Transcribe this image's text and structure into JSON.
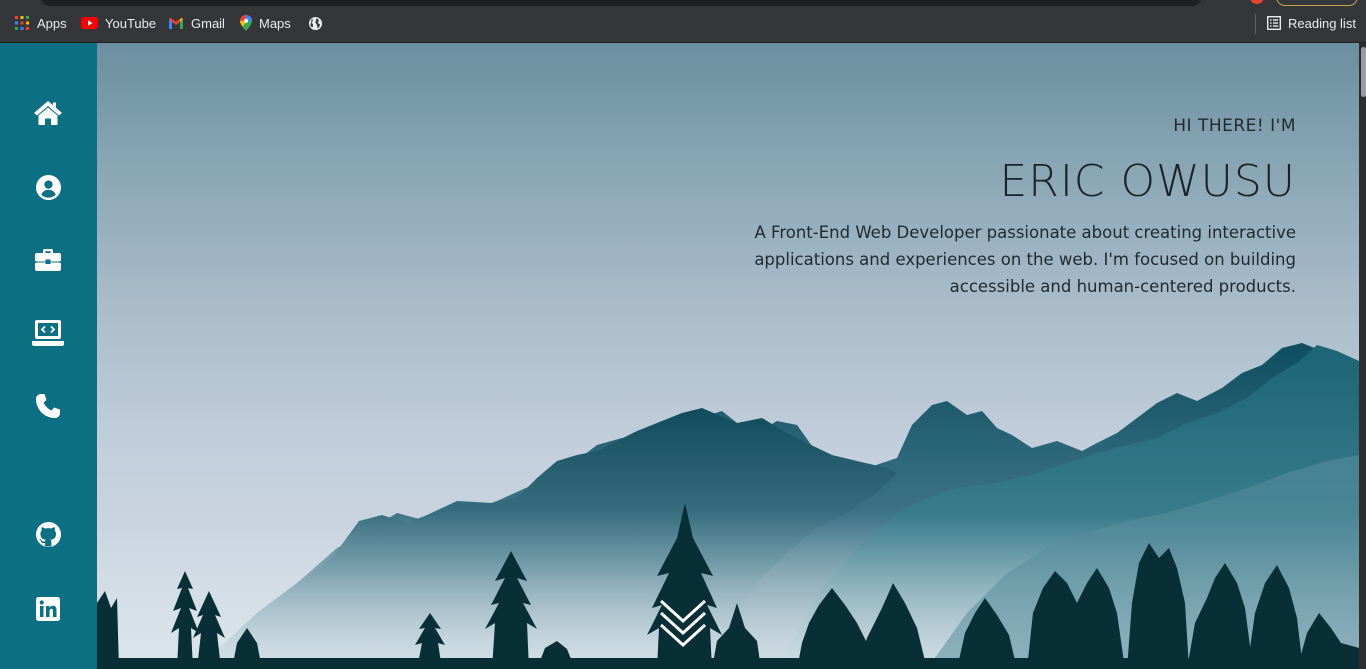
{
  "bookmarks_bar": {
    "items": [
      {
        "label": "Apps",
        "icon": "apps-grid-icon"
      },
      {
        "label": "YouTube",
        "icon": "youtube-icon"
      },
      {
        "label": "Gmail",
        "icon": "gmail-icon"
      },
      {
        "label": "Maps",
        "icon": "maps-pin-icon"
      },
      {
        "label": "",
        "icon": "globe-icon"
      }
    ],
    "reading_list": {
      "label": "Reading list",
      "icon": "reading-list-icon"
    }
  },
  "sidebar": {
    "nav": [
      {
        "name": "home",
        "icon": "home-icon"
      },
      {
        "name": "about",
        "icon": "user-circle-icon"
      },
      {
        "name": "experience",
        "icon": "briefcase-icon"
      },
      {
        "name": "projects",
        "icon": "laptop-code-icon"
      },
      {
        "name": "contact",
        "icon": "phone-icon"
      }
    ],
    "social": [
      {
        "name": "github",
        "icon": "github-icon"
      },
      {
        "name": "linkedin",
        "icon": "linkedin-icon"
      }
    ]
  },
  "hero": {
    "greeting": "HI THERE! I'M",
    "name": "ERIC OWUSU",
    "tagline_lines": [
      "A Front-End Web Developer passionate about creating interactive",
      "applications and experiences on the web. I'm focused on building",
      "accessible and human-centered products."
    ],
    "scroll_icon": "chevrons-down-icon"
  },
  "colors": {
    "sidebar": "#0d6f83",
    "browser_bar": "#35363a",
    "mountain_dark": "#0d4a5c",
    "tree": "#082f36"
  }
}
